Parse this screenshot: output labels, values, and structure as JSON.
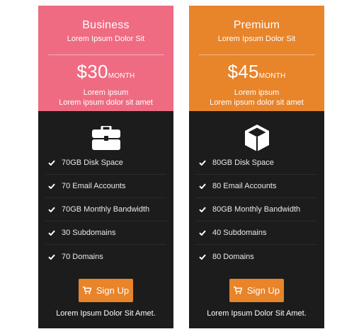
{
  "plans": [
    {
      "name": "Business",
      "tagline": "Lorem Ipsum Dolor Sit",
      "price": "$30",
      "period": "MONTH",
      "desc_line1": "Lorem ipsum",
      "desc_line2": "Lorem ipsum dolor sit amet",
      "icon": "briefcase-icon",
      "header_color": "#ef6b82",
      "features": [
        "70GB Disk Space",
        "70 Email Accounts",
        "70GB Monthly Bandwidth",
        "30 Subdomains",
        "70 Domains"
      ],
      "button_label": "Sign Up",
      "footnote": "Lorem Ipsum Dolor Sit Amet."
    },
    {
      "name": "Premium",
      "tagline": "Lorem Ipsum Dolor Sit",
      "price": "$45",
      "period": "MONTH",
      "desc_line1": "Lorem ipsum",
      "desc_line2": "Lorem ipsum dolor sit amet",
      "icon": "cube-icon",
      "header_color": "#e8842a",
      "features": [
        "80GB Disk Space",
        "80 Email Accounts",
        "80GB Monthly Bandwidth",
        "40 Subdomains",
        "80 Domains"
      ],
      "button_label": "Sign Up",
      "footnote": "Lorem Ipsum Dolor Sit Amet."
    }
  ],
  "colors": {
    "card_body": "#1c1c1c",
    "button": "#e8842a",
    "feature_text": "#e9e9e9"
  }
}
